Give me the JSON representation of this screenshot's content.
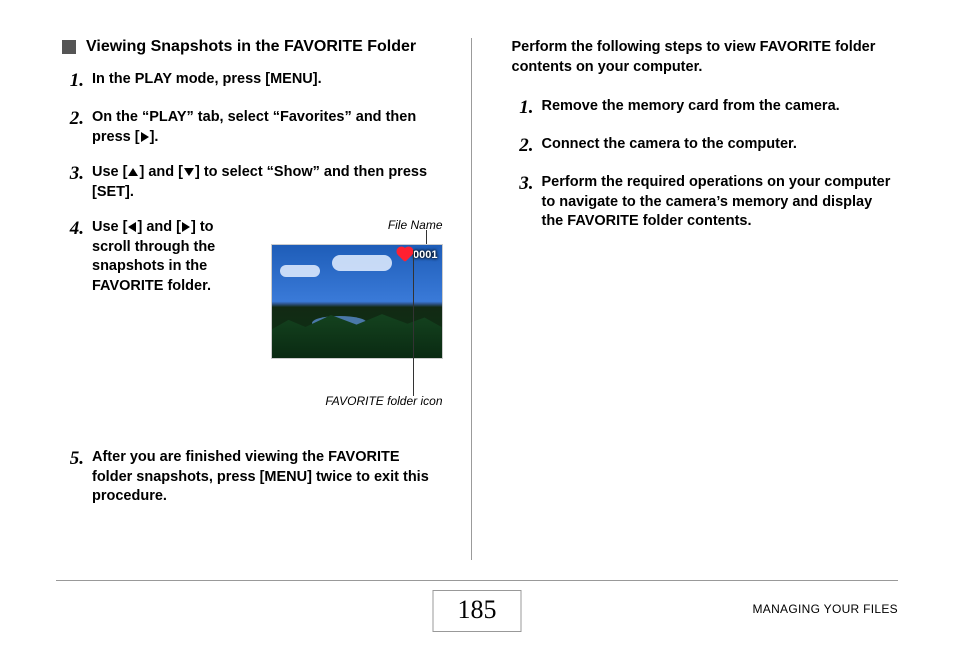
{
  "left": {
    "heading": "Viewing Snapshots in the FAVORITE Folder",
    "steps": {
      "s1": "In the PLAY mode, press [MENU].",
      "s2_a": "On the “PLAY” tab, select “Favorites” and then press [",
      "s2_b": "].",
      "s3_a": "Use [",
      "s3_b": "] and [",
      "s3_c": "] to select “Show” and then press [SET].",
      "s4_a": "Use [",
      "s4_b": "] and [",
      "s4_c": "] to scroll through the snapshots in the FAVORITE folder.",
      "s5": "After you are finished viewing the FAVORITE folder snapshots, press [MENU] twice to exit this procedure."
    },
    "fig": {
      "file_name": "File Name",
      "overlay_num": "0001",
      "icon_label": "FAVORITE folder icon"
    }
  },
  "right": {
    "intro": "Perform the following steps to view FAVORITE folder contents on your computer.",
    "steps": {
      "r1": "Remove the memory card from the camera.",
      "r2": "Connect the camera to the computer.",
      "r3": "Perform the required operations on your computer to navigate to the camera’s memory and display the FAVORITE folder contents."
    }
  },
  "footer": {
    "page_num": "185",
    "chapter": "MANAGING YOUR FILES"
  },
  "nums": {
    "n1": "1.",
    "n2": "2.",
    "n3": "3.",
    "n4": "4.",
    "n5": "5."
  }
}
